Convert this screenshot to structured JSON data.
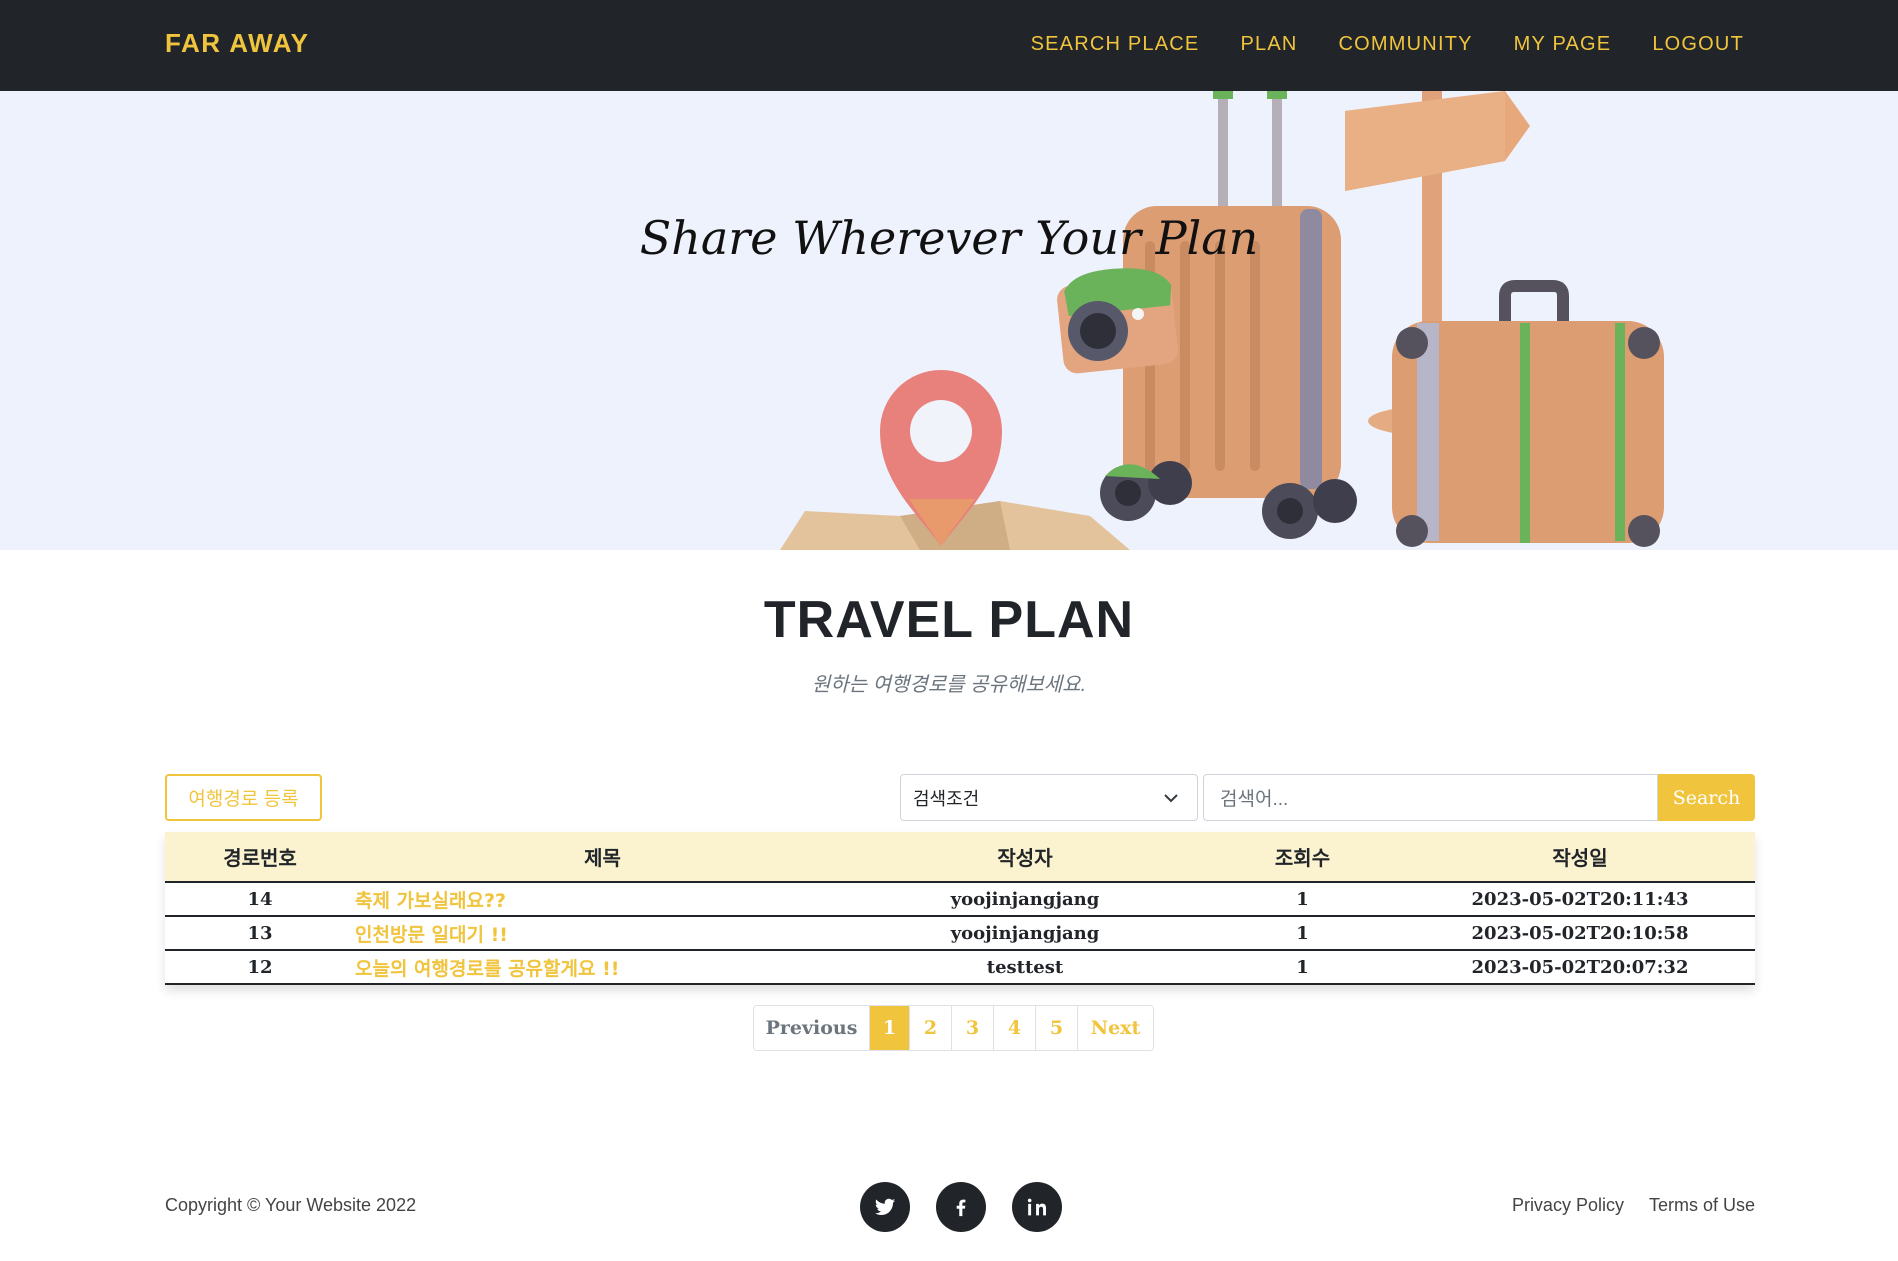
{
  "navbar": {
    "brand": "FAR AWAY",
    "links": [
      "SEARCH PLACE",
      "PLAN",
      "COMMUNITY",
      "MY PAGE",
      "LOGOUT"
    ]
  },
  "hero": {
    "title": "Share Wherever Your Plan"
  },
  "section": {
    "heading": "TRAVEL PLAN",
    "subheading": "원하는 여행경로를 공유해보세요."
  },
  "controls": {
    "register_label": "여행경로 등록",
    "select_value": "검색조건",
    "search_placeholder": "검색어...",
    "search_label": "Search"
  },
  "table": {
    "headers": [
      "경로번호",
      "제목",
      "작성자",
      "조회수",
      "작성일"
    ],
    "rows": [
      {
        "id": "14",
        "title": "축제 가보실래요??",
        "author": "yoojinjangjang",
        "views": "1",
        "date": "2023-05-02T20:11:43"
      },
      {
        "id": "13",
        "title": "인천방문 일대기 !!",
        "author": "yoojinjangjang",
        "views": "1",
        "date": "2023-05-02T20:10:58"
      },
      {
        "id": "12",
        "title": "오늘의 여행경로를 공유할게요 !!",
        "author": "testtest",
        "views": "1",
        "date": "2023-05-02T20:07:32"
      }
    ]
  },
  "pagination": {
    "previous": "Previous",
    "pages": [
      "1",
      "2",
      "3",
      "4",
      "5"
    ],
    "next": "Next",
    "active": "1"
  },
  "footer": {
    "copyright": "Copyright © Your Website 2022",
    "socials": [
      "twitter-icon",
      "facebook-icon",
      "linkedin-icon"
    ],
    "links": [
      "Privacy Policy",
      "Terms of Use"
    ]
  },
  "colors": {
    "accent": "#f0c43d",
    "dark": "#212529",
    "header_row": "#fbf2cf",
    "hero_bg": "#eef2fc"
  }
}
